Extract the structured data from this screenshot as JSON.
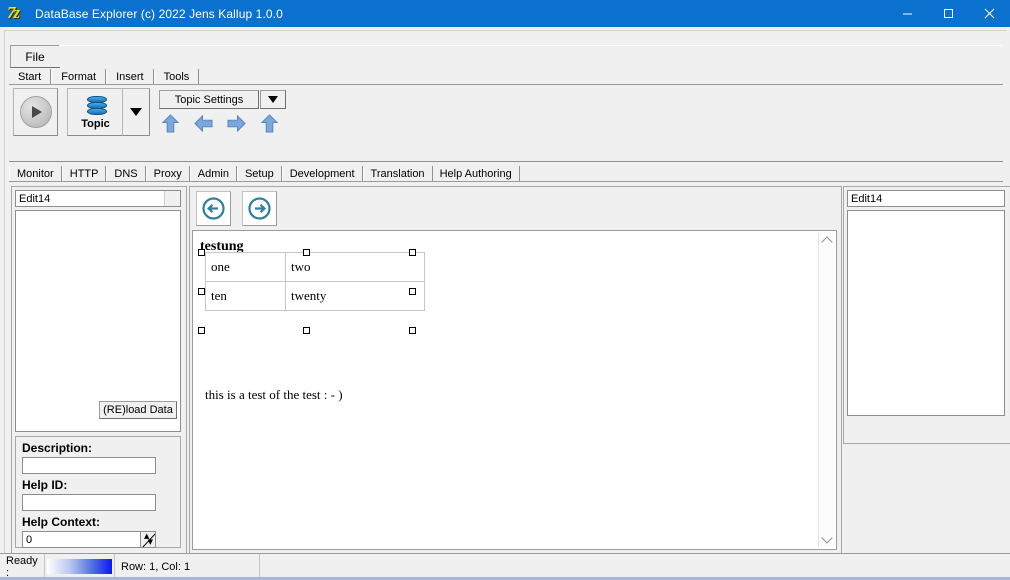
{
  "window": {
    "title": "DataBase Explorer (c) 2022 Jens Kallup 1.0.0",
    "app_icon": "7z-logo-icon",
    "minimize_label": "–",
    "maximize_label": "□",
    "close_label": "✕"
  },
  "menubar": {
    "file_label": "File"
  },
  "ribbon": {
    "tabs": [
      {
        "label": "Start",
        "active": true
      },
      {
        "label": "Format",
        "active": false
      },
      {
        "label": "Insert",
        "active": false
      },
      {
        "label": "Tools",
        "active": false
      }
    ],
    "play_button": "run-icon",
    "topic_button_label": "Topic",
    "topic_button_icon": "database-stack-icon",
    "topic_dropdown_icon": "caret-down-icon",
    "topic_settings_label": "Topic Settings",
    "topic_settings_dropdown_icon": "caret-down-icon",
    "arrows": [
      {
        "name": "arrow-up-icon",
        "dir": "up"
      },
      {
        "name": "arrow-left-icon",
        "dir": "left"
      },
      {
        "name": "arrow-right-icon",
        "dir": "right"
      },
      {
        "name": "arrow-up-2-icon",
        "dir": "up"
      }
    ],
    "arrow_color": "#7ba7dd"
  },
  "page_tabs": [
    {
      "label": "Monitor",
      "active": false
    },
    {
      "label": "HTTP",
      "active": false
    },
    {
      "label": "DNS",
      "active": false
    },
    {
      "label": "Proxy",
      "active": false
    },
    {
      "label": "Admin",
      "active": false
    },
    {
      "label": "Setup",
      "active": false
    },
    {
      "label": "Development",
      "active": false
    },
    {
      "label": "Translation",
      "active": false
    },
    {
      "label": "Help Authoring",
      "active": true
    }
  ],
  "left_panel": {
    "combo_value": "Edit14",
    "reload_button_label": "(RE)load Data",
    "fields": [
      {
        "label": "Description:",
        "value": "",
        "name": "description"
      },
      {
        "label": "Help ID:",
        "value": "",
        "name": "help-id"
      },
      {
        "label": "Help Context:",
        "value": "0",
        "name": "help-context"
      }
    ]
  },
  "editor": {
    "nav_back_icon": "circle-arrow-left-icon",
    "nav_forward_icon": "circle-arrow-right-icon",
    "heading": "testung",
    "table": {
      "rows": [
        [
          "one",
          "two"
        ],
        [
          "ten",
          "twenty"
        ]
      ]
    },
    "body_text": "this is a test of the test : - )",
    "scroll_up_icon": "chevron-up-icon",
    "scroll_down_icon": "chevron-down-icon"
  },
  "right_panel": {
    "combo_value": "Edit14"
  },
  "statusbar": {
    "ready_label": "Ready :",
    "progress_percent": 100,
    "rowcol_label": "Row: 1, Col: 1",
    "extra": ""
  },
  "colors": {
    "titlebar": "#0b71ce",
    "face": "#f0f0f0",
    "accent_arrow": "#7ba7dd",
    "nav_icon": "#2e7f9e",
    "progress_end": "#0d18f2"
  }
}
